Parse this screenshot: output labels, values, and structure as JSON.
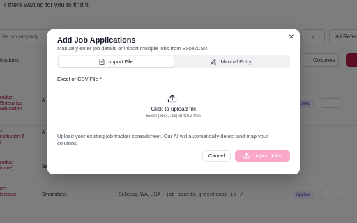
{
  "background": {
    "subtitle": "r there waiting for you to find it.",
    "search_placeholder": "tle or company...",
    "filter_chevron": "⌄",
    "all_filter": "All Referre",
    "column_header": "ications",
    "columns_button": "Columns",
    "rows": [
      {
        "position": "roduct\nEnterprise\nEducation",
        "company": "A",
        "location": "",
        "link": "",
        "status": "Applied"
      },
      {
        "position": "s\nntribution &\nt",
        "company": "A",
        "location": "",
        "link": "",
        "status": ""
      },
      {
        "position": "roduct\nimote)",
        "company": "Se",
        "location": "",
        "link": "",
        "status": ""
      },
      {
        "position": "uct\nference",
        "company": "Smartsheet",
        "location": "Bellevue, WA, USA",
        "link": "job-boards.greenhouse.io ↗",
        "status": "Applied"
      }
    ]
  },
  "modal": {
    "title": "Add Job Applications",
    "description": "Manually enter job details or import multiple jobs from Excel/CSV.",
    "close_icon": "close-icon",
    "tabs": [
      {
        "label": "Import File",
        "icon": "file-icon",
        "active": true
      },
      {
        "label": "Manual Entry",
        "icon": "pencil-icon",
        "active": false
      }
    ],
    "field_label": "Excel or CSV File *",
    "upload": {
      "icon": "upload-icon",
      "title": "Click to upload file",
      "hint": "Excel (.xlsx, .xls) or CSV files"
    },
    "help_text": "Upload your existing job tracker spreadsheet. Our AI will automatically detect and map your columns.",
    "cancel_label": "Cancel",
    "import_label": "Import Jobs",
    "import_color": "#f9a8c9"
  }
}
